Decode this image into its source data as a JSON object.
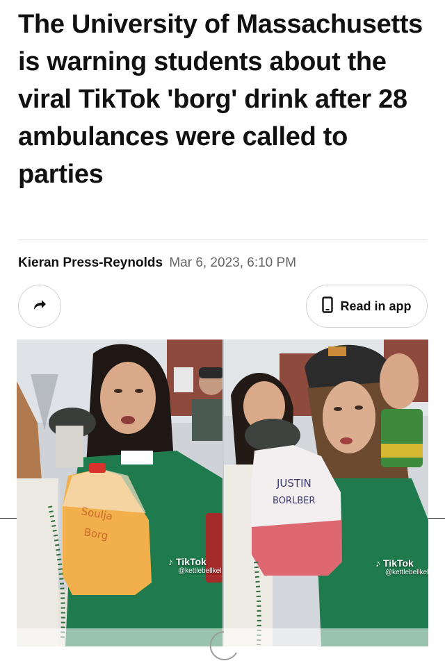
{
  "article": {
    "headline": "The University of Massachusetts is warning students about the viral TikTok 'borg' drink after 28 ambulances were called to parties",
    "author": "Kieran Press-Reynolds",
    "date": "Mar 6, 2023, 6:10 PM"
  },
  "actions": {
    "share_icon": "share-arrow-icon",
    "read_in_app_label": "Read in app",
    "read_in_app_icon": "phone-icon"
  },
  "media": {
    "left": {
      "jug_text_line1": "Soulja",
      "jug_text_line2": "Borg",
      "watermark_brand": "TikTok",
      "watermark_user": "@kettlebellkel"
    },
    "right": {
      "jug_text_line1": "JUSTIN",
      "jug_text_line2": "BORLBER",
      "watermark_brand": "TikTok",
      "watermark_user": "@kettlebellkel"
    }
  },
  "colors": {
    "text": "#111111",
    "muted": "#666666",
    "border": "#d2d2d2",
    "jersey_green": "#1f7a4d"
  }
}
